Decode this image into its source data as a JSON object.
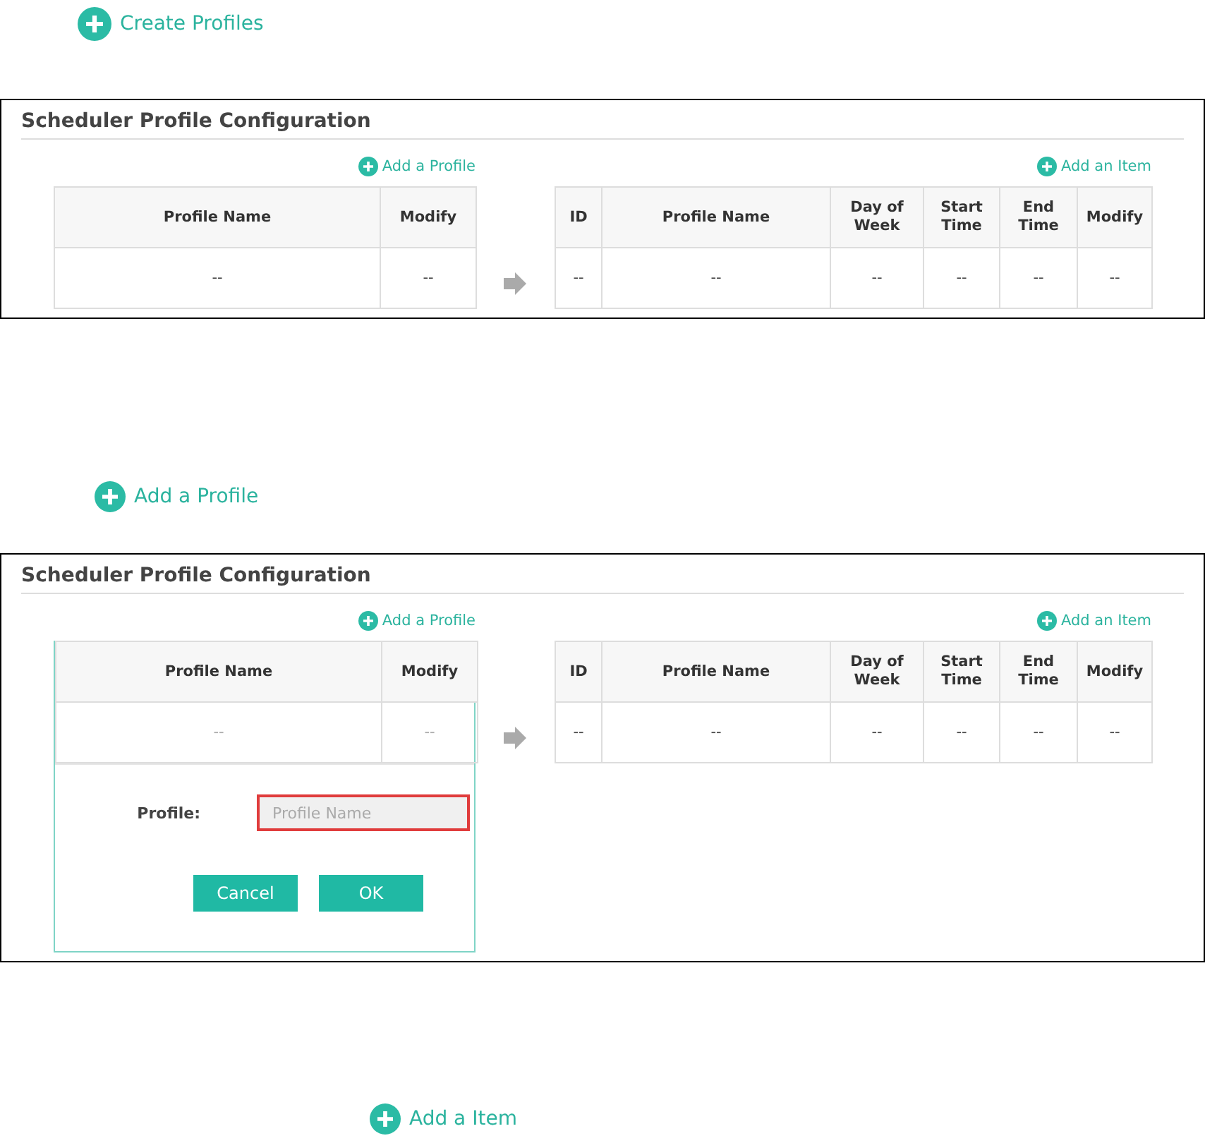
{
  "steps": [
    {
      "label": "Create Profiles",
      "panel": {
        "title": "Scheduler Profile Configuration",
        "profile_add": "Add a Profile",
        "item_add": "Add an Item",
        "profile_table": {
          "columns": [
            "Profile Name",
            "Modify"
          ],
          "rows": [
            [
              "--",
              "--"
            ]
          ]
        },
        "item_table": {
          "columns": [
            "ID",
            "Profile Name",
            "Day of Week",
            "Start Time",
            "End Time",
            "Modify"
          ],
          "rows": [
            [
              "--",
              "--",
              "--",
              "--",
              "--",
              "--"
            ]
          ]
        }
      }
    },
    {
      "label": "Add a Profile",
      "panel": {
        "title": "Scheduler Profile Configuration",
        "profile_add": "Add a Profile",
        "item_add": "Add an Item",
        "profile_table": {
          "columns": [
            "Profile Name",
            "Modify"
          ],
          "rows": [
            [
              "--",
              "--"
            ]
          ]
        },
        "item_table": {
          "columns": [
            "ID",
            "Profile Name",
            "Day of Week",
            "Start Time",
            "End Time",
            "Modify"
          ],
          "rows": [
            [
              "--",
              "--",
              "--",
              "--",
              "--",
              "--"
            ]
          ]
        },
        "form": {
          "label": "Profile:",
          "placeholder": "Profile Name",
          "invalid": true,
          "buttons": [
            "Cancel",
            "OK"
          ]
        }
      }
    },
    {
      "label": "Add a Item"
    }
  ]
}
